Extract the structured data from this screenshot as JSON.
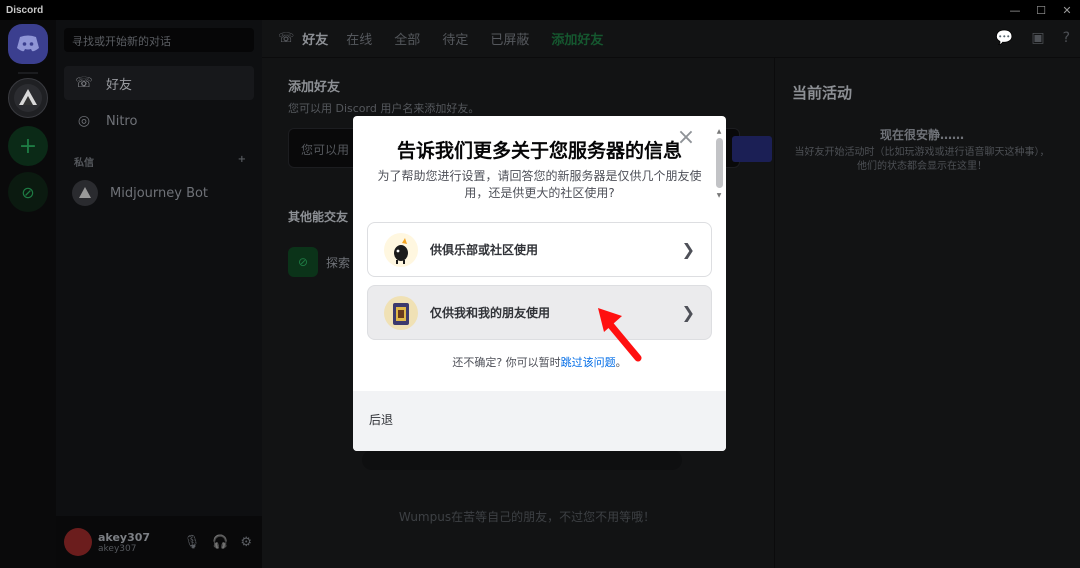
{
  "window": {
    "title": "Discord"
  },
  "rail": {
    "home_label": "",
    "server_label": "",
    "add_label": "+",
    "explore_label": ""
  },
  "sidebar": {
    "search_placeholder": "寻找或开始新的对话",
    "items": [
      {
        "label": "好友"
      },
      {
        "label": "Nitro"
      }
    ],
    "dm_header": "私信",
    "dm_add": "+",
    "dms": [
      {
        "name": "Midjourney Bot"
      }
    ],
    "user": {
      "name": "akey307",
      "tag": "akey307"
    }
  },
  "topbar": {
    "title": "好友",
    "tabs": [
      "在线",
      "全部",
      "待定",
      "已屏蔽"
    ],
    "add_friend": "添加好友"
  },
  "main": {
    "add_title": "添加好友",
    "add_desc": "您可以用 Discord 用户名来添加好友。",
    "add_placeholder": "您可以用",
    "other_title": "其他能交友",
    "explore_label": "探索",
    "wumpus_text": "Wumpus在苦等自己的朋友，不过您不用等哦！"
  },
  "activity": {
    "title": "当前活动",
    "quiet": "现在很安静……",
    "desc": "当好友开始活动时（比如玩游戏或进行语音聊天这种事），他们的状态都会显示在这里！"
  },
  "modal": {
    "title": "告诉我们更多关于您服务器的信息",
    "desc": "为了帮助您进行设置，请回答您的新服务器是仅供几个朋友使用，还是供更大的社区使用?",
    "options": [
      {
        "label": "供俱乐部或社区使用"
      },
      {
        "label": "仅供我和我的朋友使用"
      }
    ],
    "unsure_prefix": "还不确定? 你可以暂时",
    "unsure_link": "跳过该问题",
    "unsure_suffix": "。",
    "back_label": "后退",
    "close_glyph": "×"
  },
  "colors": {
    "annotation_arrow": "#ff1010",
    "link": "#006ce7",
    "blurple": "#5865f2"
  }
}
